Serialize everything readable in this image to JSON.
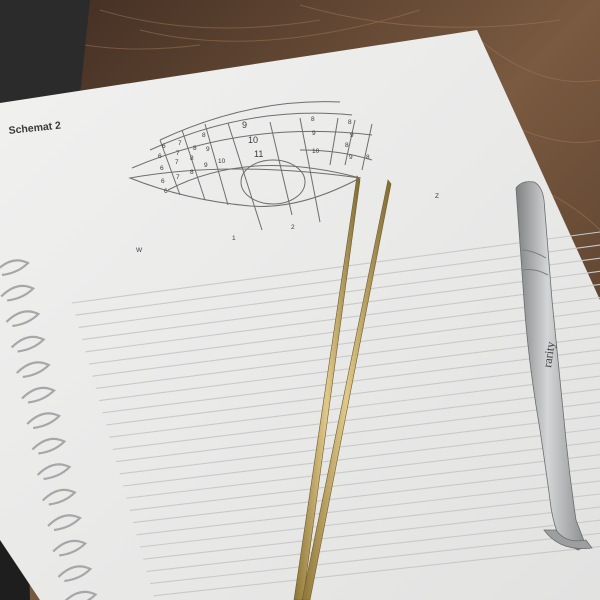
{
  "notebook": {
    "title": "Schemat 2",
    "zone_numbers": {
      "upper": [
        "9",
        "10",
        "11"
      ],
      "left": [
        "6",
        "7",
        "8",
        "6",
        "7",
        "8",
        "6",
        "7",
        "8",
        "9",
        "6",
        "7",
        "8",
        "9",
        "10",
        "6"
      ],
      "right": [
        "8",
        "9",
        "8",
        "9",
        "10",
        "8",
        "9",
        "8"
      ],
      "bottom": [
        "W",
        "1",
        "2",
        "Z"
      ]
    }
  },
  "tweezers": {
    "brand": "rarity"
  },
  "colors": {
    "paper": "#ececeb",
    "lines": "#c9c9c9",
    "diagram": "#6e6e6e",
    "gold_tweezers": "#b59a55",
    "steel_tweezers": "#a9aaab",
    "fur": "#6b4a34"
  }
}
